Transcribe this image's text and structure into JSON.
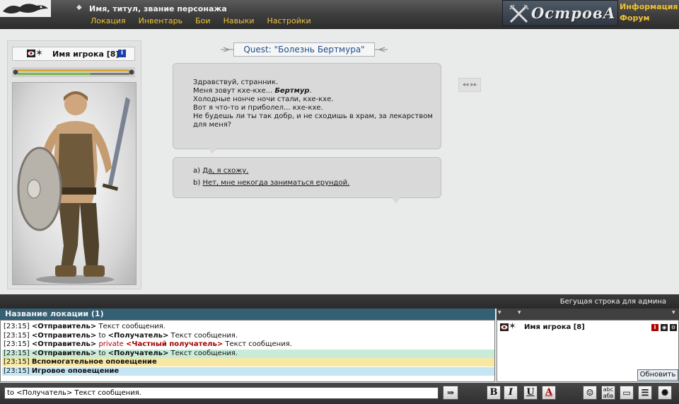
{
  "header": {
    "character_title": "Имя, титул, звание персонажа",
    "nav": [
      "Локация",
      "Инвентарь",
      "Бои",
      "Навыки",
      "Настройки"
    ],
    "logo_text": "ОстровА",
    "right_links": [
      "Информация",
      "Форум"
    ]
  },
  "player_card": {
    "name": "Имя игрока [8]",
    "info_badge": "i",
    "health_fraction": 1.0,
    "mana_fraction": 0.65
  },
  "quest": {
    "title": "Quest: \"Болезнь Бертмура\"",
    "dialog": [
      "Здравствуй, странник.",
      "Меня зовут кхе-кхе... ",
      "Бертмур",
      ".",
      "Холодные нонче ночи стали, кхе-кхе.",
      "Вот я что-то и приболел... кхе-кхе.",
      "Не будешь ли ты так добр, и не сходишь в храм, за лекарством для меня?"
    ],
    "answers": [
      {
        "prefix": "a)",
        "text": "Да, я схожу."
      },
      {
        "prefix": "b)",
        "text": "Нет, мне некогда заниматься ерундой."
      }
    ]
  },
  "ticker": "Бегущая строка для админа",
  "location_bar": "Название локации (1)",
  "chat": {
    "lines": [
      {
        "time": "[23:15]",
        "sender": "<Отправитель>",
        "to": "",
        "recipient": "",
        "text": "Текст сообщения.",
        "bg": "#ffffff"
      },
      {
        "time": "[23:15]",
        "sender": "<Отправитель>",
        "to": "to",
        "recipient": "<Получатель>",
        "text": "Текст сообщения.",
        "bg": "#ffffff"
      },
      {
        "time": "[23:15]",
        "sender": "<Отправитель>",
        "to": "private",
        "recipient": "<Частный получатель>",
        "text": "Текст сообщения.",
        "bg": "#ffffff"
      },
      {
        "time": "[23:15]",
        "sender": "<Отправитель>",
        "to": "to",
        "recipient": "<Получатель>",
        "text": "Текст сообщения.",
        "bg": "#c9ecd9"
      },
      {
        "time": "[23:15]",
        "sender": "",
        "to": "",
        "recipient": "",
        "text": "Вспомогательное оповещение",
        "bg": "#f7e8a3"
      },
      {
        "time": "[23:15]",
        "sender": "",
        "to": "",
        "recipient": "",
        "text": "Игровое оповещение",
        "bg": "#c6e5f2"
      }
    ]
  },
  "users_panel": {
    "user_name": "Имя игрока [8]",
    "refresh_label": "Обновить"
  },
  "message_input": {
    "value": "to <Получатель> Текст сообщения."
  },
  "toolbar": {
    "bold": "B",
    "italic": "I",
    "underline": "U",
    "color": "A"
  },
  "colors": {
    "link_accent": "#f1c232",
    "quest_title": "#1f4e8c",
    "private_red": "#a40000",
    "location_bar": "#355f73"
  },
  "icons": [
    "dragon-logo-icon",
    "crossed-swords-icon",
    "eye-icon",
    "star-icon",
    "info-icon",
    "reply-arrow-icon",
    "smiley-icon",
    "spellcheck-icon",
    "window-icon",
    "list-icon",
    "globe-icon"
  ]
}
